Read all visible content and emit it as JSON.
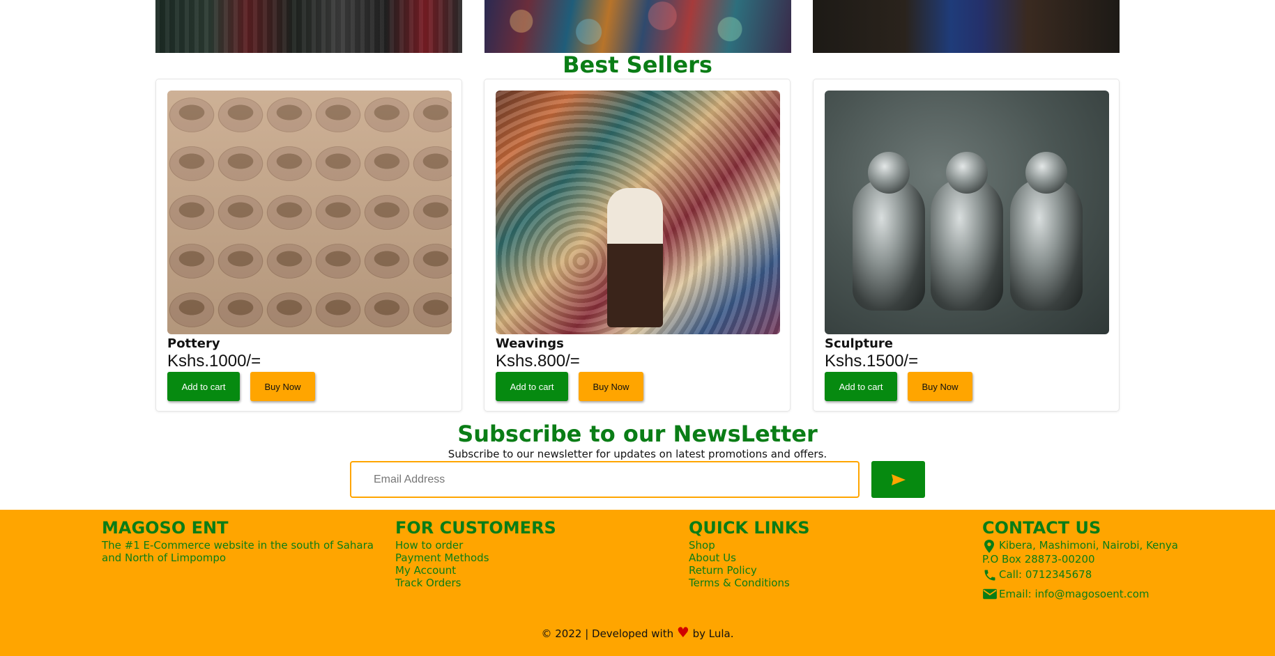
{
  "best_sellers": {
    "title": "Best Sellers",
    "products": [
      {
        "name": "Pottery",
        "price": "Kshs.1000/=",
        "add_to_cart": "Add to cart",
        "buy_now": "Buy Now"
      },
      {
        "name": "Weavings",
        "price": "Kshs.800/=",
        "add_to_cart": "Add to cart",
        "buy_now": "Buy Now"
      },
      {
        "name": "Sculpture",
        "price": "Kshs.1500/=",
        "add_to_cart": "Add to cart",
        "buy_now": "Buy Now"
      }
    ]
  },
  "newsletter": {
    "title": "Subscribe to our NewsLetter",
    "description": "Subscribe to our newsletter for updates on latest promotions and offers.",
    "email_placeholder": "Email Address",
    "send_icon": "send-icon"
  },
  "footer": {
    "brand": {
      "title": "MAGOSO ENT",
      "tagline": "The #1 E-Commerce website in the south of Sahara and North of Limpompo"
    },
    "customers": {
      "title": "FOR CUSTOMERS",
      "links": [
        "How to order",
        "Payment Methods",
        "My Account",
        "Track Orders"
      ]
    },
    "quick_links": {
      "title": "QUICK LINKS",
      "links": [
        "Shop",
        "About Us",
        "Return Policy",
        "Terms & Conditions"
      ]
    },
    "contact": {
      "title": "CONTACT US",
      "address": "Kibera, Mashimoni, Nairobi, Kenya",
      "po_box": "P.O Box 28873-00200",
      "phone": "Call: 0712345678",
      "email": "Email: info@magosoent.com",
      "icons": [
        "location-pin-icon",
        "phone-icon",
        "mail-icon"
      ]
    },
    "copyright_prefix": "© 2022 | Developed with",
    "copyright_suffix": "by Lula.",
    "heart_icon": "heart-icon"
  },
  "colors": {
    "brand_green": "#0a7d16",
    "button_green": "#068a10",
    "accent_orange": "#ffa500",
    "heart_red": "#d00000"
  }
}
